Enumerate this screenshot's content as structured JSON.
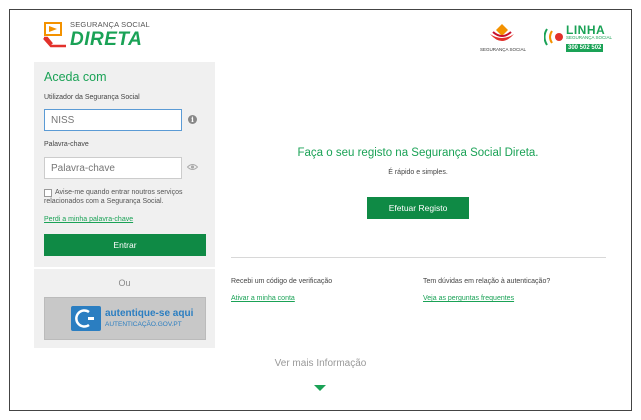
{
  "header": {
    "logo_small": "SEGURANÇA SOCIAL",
    "logo_big": "DIRETA",
    "ss_logo_text": "SEGURANÇA SOCIAL",
    "linha_title": "LINHA",
    "linha_sub": "SEGURANÇA SOCIAL",
    "linha_number": "300 502 502"
  },
  "login": {
    "title": "Aceda com",
    "user_label": "Utilizador da Segurança Social",
    "user_placeholder": "NISS",
    "pass_label": "Palavra-chave",
    "pass_placeholder": "Palavra-chave",
    "remember_text": "Avise-me quando entrar noutros serviços relacionados com a Segurança Social.",
    "forgot_link": "Perdi a minha palavra-chave",
    "enter_button": "Entrar",
    "or_text": "Ou",
    "autentique_title": "autentique-se aqui",
    "autentique_sub": "AUTENTICAÇÃO.GOV.PT"
  },
  "register": {
    "title": "Faça o seu registo na Segurança Social Direta.",
    "subtitle": "É rápido e simples.",
    "button": "Efetuar Registo"
  },
  "help": {
    "q1": "Recebi um código de verificação",
    "a1": "Ativar a minha conta",
    "q2": "Tem dúvidas em relação à autenticação?",
    "a2": "Veja as perguntas frequentes"
  },
  "footer": {
    "more_info": "Ver mais Informação"
  },
  "colors": {
    "brand_green": "#1aa256",
    "button_green": "#0f8a45",
    "autentique_blue": "#2b7ec1"
  }
}
